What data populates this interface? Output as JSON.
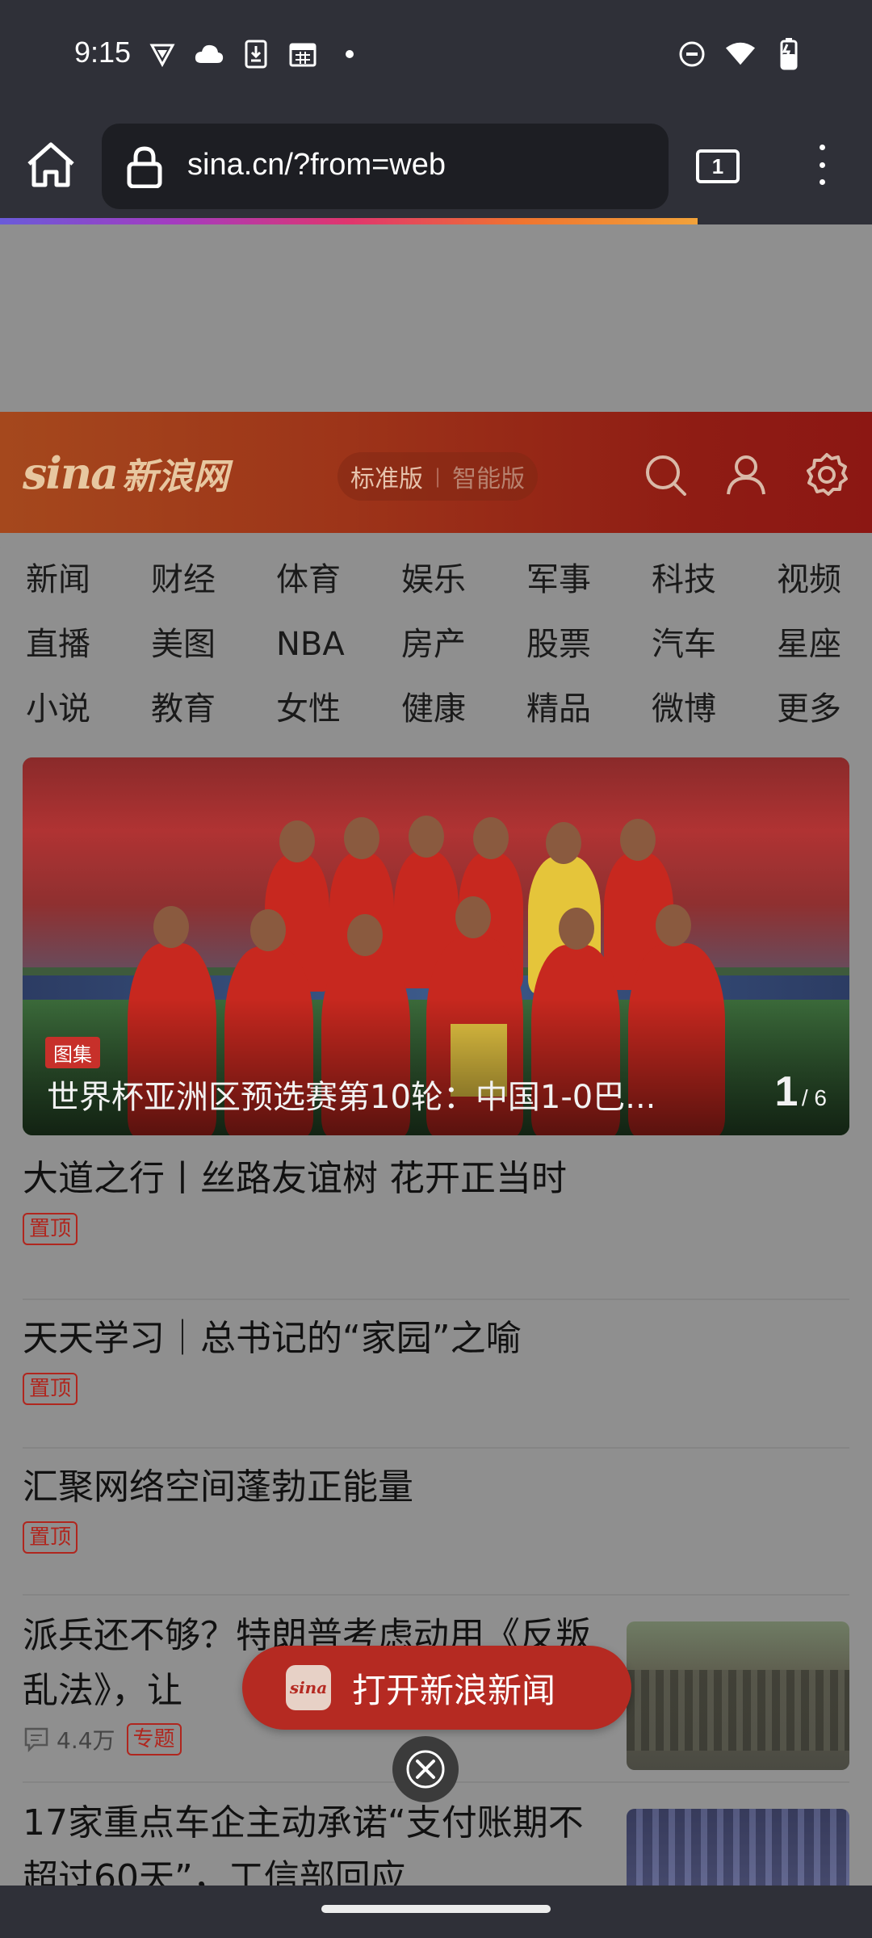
{
  "status_bar": {
    "time": "9:15",
    "left_icons": [
      "vpn-shield-icon",
      "cloud-icon",
      "download-icon",
      "calendar-icon",
      "dot-icon"
    ],
    "right_icons": [
      "dnd-icon",
      "wifi-icon",
      "battery-icon"
    ]
  },
  "browser": {
    "url": "sina.cn/?from=web",
    "tab_count": "1",
    "load_progress": 0.8
  },
  "header": {
    "logo_text": "sina",
    "logo_cn": "新浪网",
    "version_standard": "标准版",
    "version_separator": "|",
    "version_smart": "智能版"
  },
  "nav": {
    "items": [
      "新闻",
      "财经",
      "体育",
      "娱乐",
      "军事",
      "科技",
      "视频",
      "直播",
      "美图",
      "NBA",
      "房产",
      "股票",
      "汽车",
      "星座",
      "小说",
      "教育",
      "女性",
      "健康",
      "精品",
      "微博",
      "更多"
    ]
  },
  "banner": {
    "tag": "图集",
    "caption": "世界杯亚洲区预选赛第10轮：中国1-0巴...",
    "page_current": "1",
    "page_total": "/ 6"
  },
  "news": [
    {
      "title": "大道之行丨丝路友谊树 花开正当时",
      "tag": "置顶"
    },
    {
      "title": "天天学习｜总书记的“家园”之喻",
      "tag": "置顶"
    },
    {
      "title": "汇聚网络空间蓬勃正能量",
      "tag": "置顶"
    },
    {
      "title": "派兵还不够？特朗普考虑动用《反叛乱法》，让",
      "comments": "4.4万",
      "tag": "专题"
    },
    {
      "title": "17家重点车企主动承诺“支付账期不超过60天”，工信部回应"
    }
  ],
  "open_app": {
    "label": "打开新浪新闻",
    "icon_text": "sina"
  },
  "colors": {
    "brand_red": "#b52a22",
    "toolbar": "#2f3038",
    "overlay_gray": "#8f8f8f"
  }
}
